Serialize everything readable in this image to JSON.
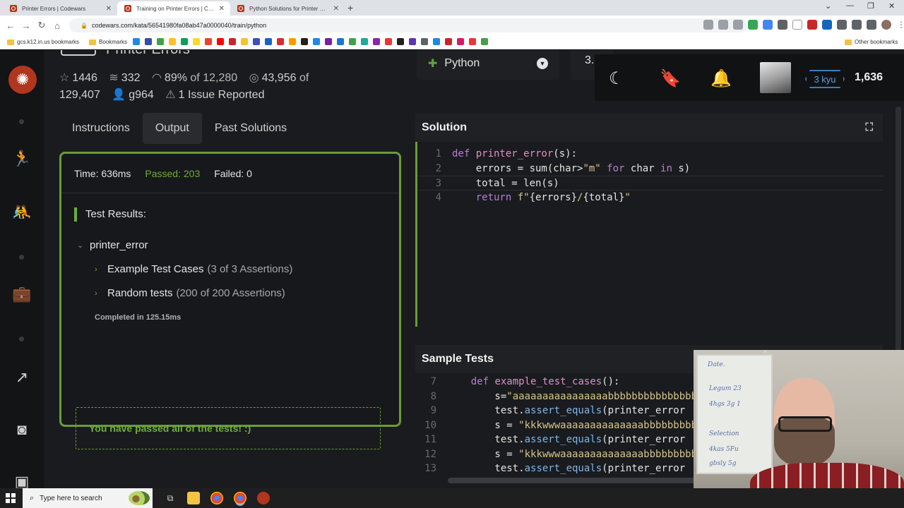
{
  "browser": {
    "tabs": [
      {
        "title": "Printer Errors | Codewars",
        "active": false
      },
      {
        "title": "Training on Printer Errors | Codewars",
        "active": true
      },
      {
        "title": "Python Solutions for Printer Errors",
        "active": false
      }
    ],
    "url": "codewars.com/kata/56541980fa08ab47a0000040/train/python",
    "bookmarks": {
      "first": "gcs.k12.in.us bookmarks",
      "second": "Bookmarks",
      "other": "Other bookmarks"
    }
  },
  "kata": {
    "title": "Printer Errors",
    "stats": {
      "favorites": "1446",
      "collections": "332",
      "satisfaction": "89%",
      "satisfaction_of": "of 12,280",
      "completed": "43,956",
      "completed_of": "of",
      "completed_total": "129,407",
      "author": "g964",
      "issues": "1 Issue Reported"
    },
    "tabs": [
      "Instructions",
      "Output",
      "Past Solutions"
    ],
    "active_tab": "Output"
  },
  "output": {
    "time": "Time: 636ms",
    "passed": "Passed: 203",
    "failed": "Failed: 0",
    "results_title": "Test Results:",
    "group": "printer_error",
    "tests": [
      {
        "name": "Example Test Cases",
        "detail": "(3 of 3 Assertions)"
      },
      {
        "name": "Random tests",
        "detail": "(200 of 200 Assertions)"
      }
    ],
    "completed": "Completed in 125.15ms",
    "passed_message": "You have passed all of the tests! :)"
  },
  "editor": {
    "language": "Python",
    "version": "3.",
    "solution_title": "Solution",
    "sample_title": "Sample Tests"
  },
  "user": {
    "rank": "3 kyu",
    "honor": "1,636"
  },
  "taskbar": {
    "search_placeholder": "Type here to search"
  },
  "webcam": {
    "board_lines": [
      "Date.",
      "Legum 23",
      "4hgs 3g 1",
      "Selection",
      "4kas 5Fu",
      "gbsly 5g"
    ]
  },
  "colors": {
    "accent_green": "#6cad3c",
    "codewars_red": "#b1361e",
    "kyu_blue": "#3c7ebb"
  }
}
